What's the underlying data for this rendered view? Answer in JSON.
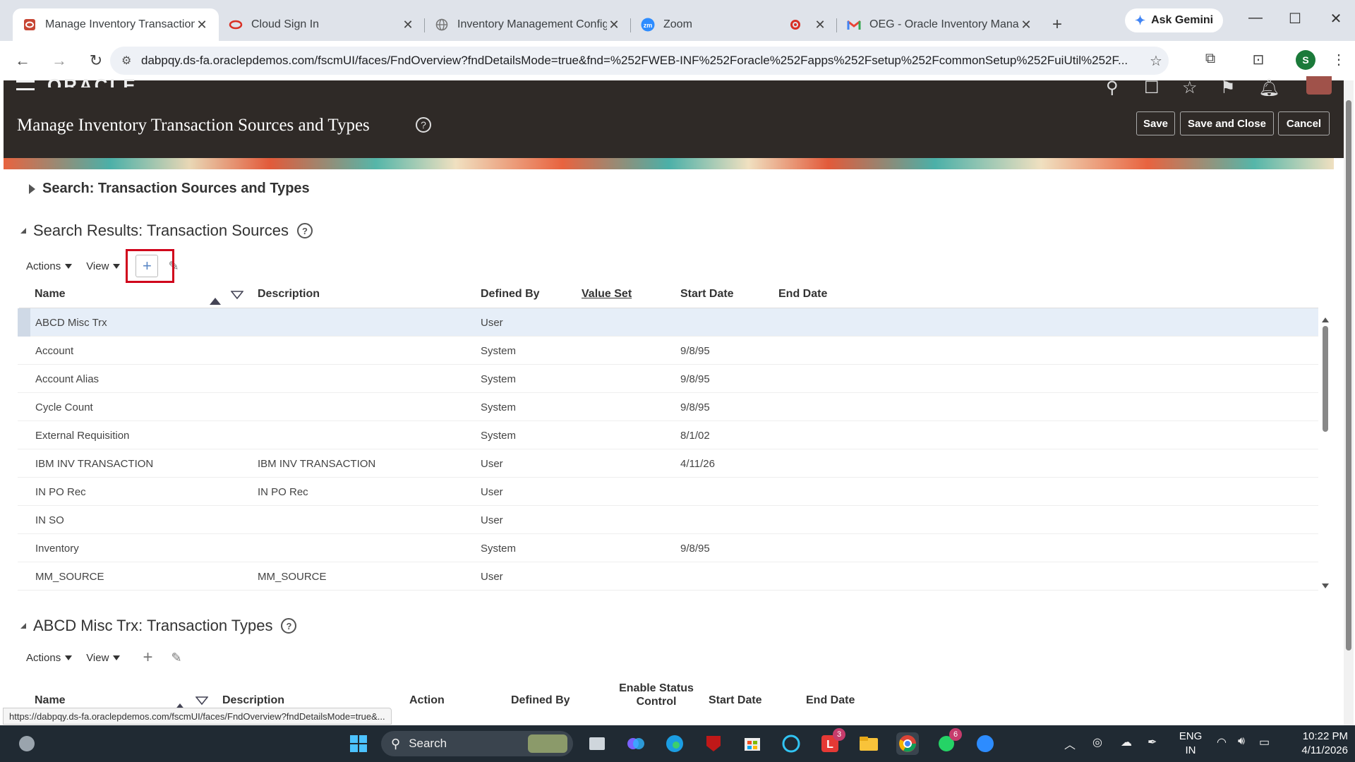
{
  "browser": {
    "tabs": [
      {
        "label": "Manage Inventory Transaction",
        "icon": "oracle-icon",
        "active": true
      },
      {
        "label": "Cloud Sign In",
        "icon": "oracle-outline-icon",
        "active": false
      },
      {
        "label": "Inventory Management Config",
        "icon": "globe-icon",
        "active": false
      },
      {
        "label": "Zoom",
        "icon": "zoom-icon",
        "active": false
      },
      {
        "label": "OEG - Oracle Inventory Manag",
        "icon": "gmail-icon",
        "active": false
      }
    ],
    "gemini_label": "Ask Gemini",
    "url": "dabpqy.ds-fa.oraclepdemos.com/fscmUI/faces/FndOverview?fndDetailsMode=true&fnd=%252FWEB-INF%252Foracle%252Fapps%252Fsetup%252FcommonSetup%252FuiUtil%252F...",
    "profile_initial": "S",
    "status_url": "https://dabpqy.ds-fa.oraclepdemos.com/fscmUI/faces/FndOverview?fndDetailsMode=true&..."
  },
  "oracle": {
    "logo": "ORACLE",
    "page_title": "Manage Inventory Transaction Sources and Types",
    "buttons": {
      "save": "Save",
      "save_close": "Save and Close",
      "cancel": "Cancel"
    }
  },
  "search_section": {
    "title": "Search: Transaction Sources and Types"
  },
  "sources": {
    "title": "Search Results: Transaction Sources",
    "toolbar": {
      "actions": "Actions",
      "view": "View"
    },
    "columns": [
      "Name",
      "Description",
      "Defined By",
      "Value Set",
      "Start Date",
      "End Date"
    ],
    "rows": [
      {
        "name": "ABCD Misc Trx",
        "description": "",
        "defined_by": "User",
        "start_date": "",
        "selected": true
      },
      {
        "name": "Account",
        "description": "",
        "defined_by": "System",
        "start_date": "9/8/95"
      },
      {
        "name": "Account Alias",
        "description": "",
        "defined_by": "System",
        "start_date": "9/8/95"
      },
      {
        "name": "Cycle Count",
        "description": "",
        "defined_by": "System",
        "start_date": "9/8/95"
      },
      {
        "name": "External Requisition",
        "description": "",
        "defined_by": "System",
        "start_date": "8/1/02"
      },
      {
        "name": "IBM INV TRANSACTION",
        "description": "IBM INV TRANSACTION",
        "defined_by": "User",
        "start_date": "4/11/26"
      },
      {
        "name": "IN PO Rec",
        "description": "IN PO Rec",
        "defined_by": "User",
        "start_date": ""
      },
      {
        "name": "IN SO",
        "description": "",
        "defined_by": "User",
        "start_date": ""
      },
      {
        "name": "Inventory",
        "description": "",
        "defined_by": "System",
        "start_date": "9/8/95"
      },
      {
        "name": "MM_SOURCE",
        "description": "MM_SOURCE",
        "defined_by": "User",
        "start_date": ""
      }
    ]
  },
  "types": {
    "title": "ABCD Misc Trx: Transaction Types",
    "toolbar": {
      "actions": "Actions",
      "view": "View"
    },
    "columns": [
      "Name",
      "Description",
      "Action",
      "Defined By",
      "Enable Status Control",
      "Start Date",
      "End Date"
    ]
  },
  "taskbar": {
    "search_label": "Search",
    "lang_line1": "ENG",
    "lang_line2": "IN",
    "time": "10:22 PM",
    "date": "4/11/2026",
    "badges": {
      "app_l": "3",
      "whatsapp": "6"
    }
  }
}
